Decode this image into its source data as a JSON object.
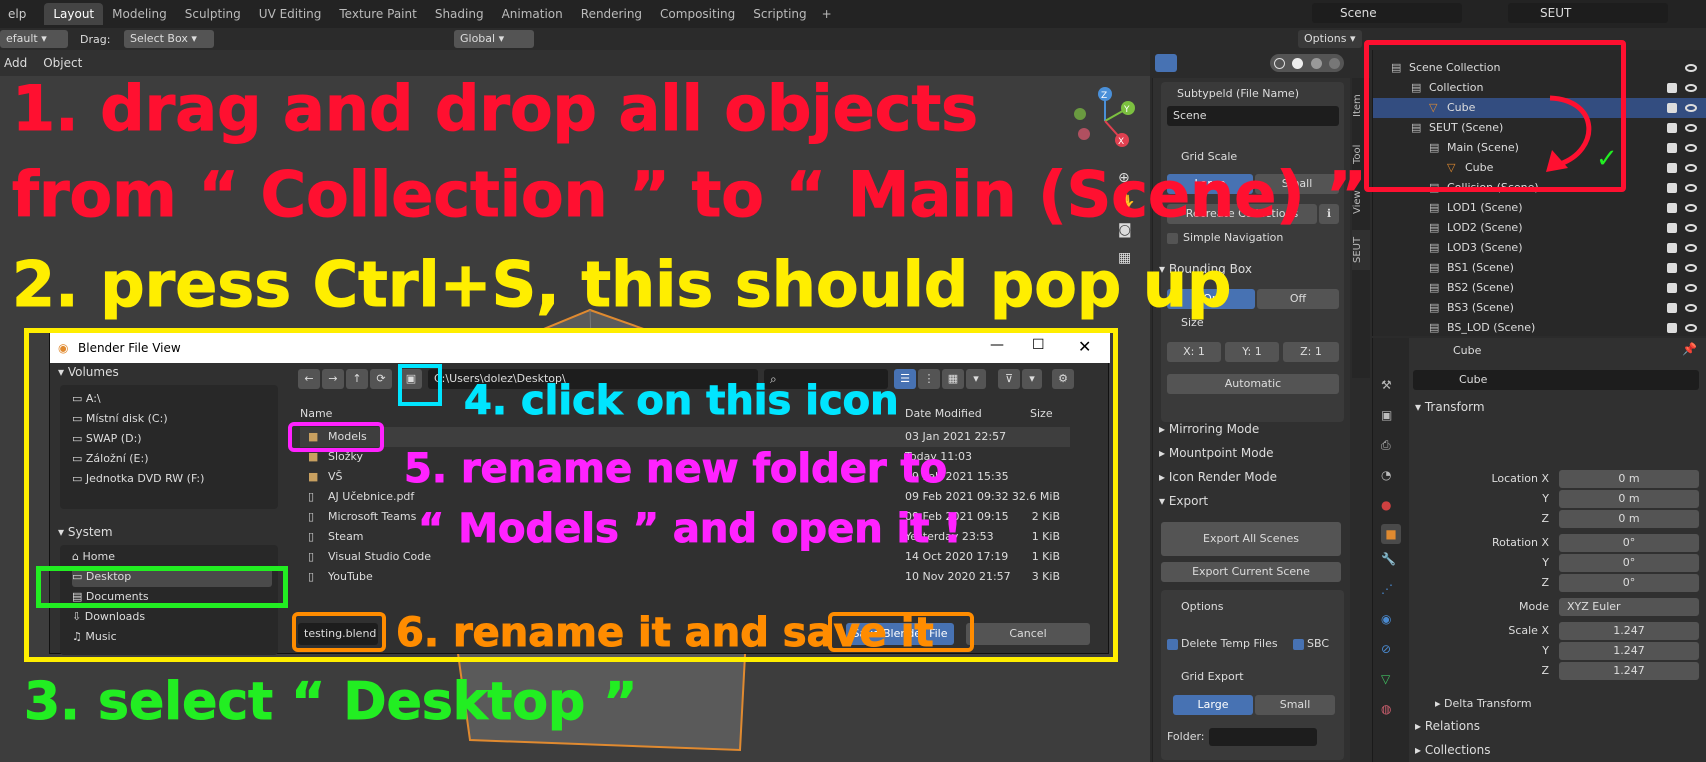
{
  "topbar": {
    "menu_help": "elp",
    "tabs": [
      "Layout",
      "Modeling",
      "Sculpting",
      "UV Editing",
      "Texture Paint",
      "Shading",
      "Animation",
      "Rendering",
      "Compositing",
      "Scripting"
    ],
    "add_tab": "+",
    "scene_name": "Scene",
    "view_layer": "SEUT"
  },
  "header2": {
    "mode": "efault",
    "drag_label": "Drag:",
    "drag_value": "Select Box",
    "orientation": "Global",
    "options": "Options"
  },
  "viewport_header": {
    "add": "Add",
    "object": "Object"
  },
  "gizmo": {
    "x": "X",
    "y": "Y",
    "z": "Z"
  },
  "npanel": {
    "subtype_label": "Subtypeld (File Name)",
    "subtype_value": "Scene",
    "grid_scale": "Grid Scale",
    "large": "Large",
    "small": "Small",
    "recreate": "Recreate Collections",
    "simple_nav": "Simple Navigation",
    "bounding_box": "Bounding Box",
    "on": "On",
    "off": "Off",
    "size": "Size",
    "bx": "X:  1",
    "by": "Y:  1",
    "bz": "Z:  1",
    "automatic": "Automatic",
    "mirroring": "Mirroring Mode",
    "mountpoint": "Mountpoint Mode",
    "icon_render": "Icon Render Mode",
    "export": "Export",
    "export_all": "Export All Scenes",
    "export_current": "Export Current Scene",
    "options": "Options",
    "delete_temp": "Delete Temp Files",
    "sbc": "SBC",
    "grid_export": "Grid Export",
    "folder": "Folder:",
    "tabs": [
      "Item",
      "Tool",
      "View",
      "SEUT"
    ]
  },
  "outliner": {
    "rows": [
      {
        "label": "Scene Collection"
      },
      {
        "label": "Collection"
      },
      {
        "label": "Cube"
      },
      {
        "label": "SEUT (Scene)"
      },
      {
        "label": "Main (Scene)"
      },
      {
        "label": "Cube"
      },
      {
        "label": "Collision (Scene)"
      },
      {
        "label": "LOD1 (Scene)"
      },
      {
        "label": "LOD2 (Scene)"
      },
      {
        "label": "LOD3 (Scene)"
      },
      {
        "label": "BS1 (Scene)"
      },
      {
        "label": "BS2 (Scene)"
      },
      {
        "label": "BS3 (Scene)"
      },
      {
        "label": "BS_LOD (Scene)"
      }
    ]
  },
  "props": {
    "object_name": "Cube",
    "object_field": "Cube",
    "transform": "Transform",
    "location_x": "Location X",
    "rotation_x": "Rotation X",
    "y": "Y",
    "z": "Z",
    "loc": [
      "0 m",
      "0 m",
      "0 m"
    ],
    "rot": [
      "0°",
      "0°",
      "0°"
    ],
    "mode_label": "Mode",
    "mode_value": "XYZ Euler",
    "scale_x": "Scale X",
    "scale": [
      "1.247",
      "1.247",
      "1.247"
    ],
    "delta": "Delta Transform",
    "relations": "Relations",
    "collections": "Collections"
  },
  "dialog": {
    "title": "Blender File View",
    "volumes": "Volumes",
    "volume_items": [
      "A:\\",
      "Místní disk (C:)",
      "SWAP (D:)",
      "Záložní (E:)",
      "Jednotka DVD RW (F:)"
    ],
    "system": "System",
    "system_items": [
      "Home",
      "Desktop",
      "Documents",
      "Downloads",
      "Music"
    ],
    "path": "C:\\Users\\dolez\\Desktop\\",
    "col_name": "Name",
    "col_date": "Date Modified",
    "col_size": "Size",
    "files": [
      {
        "name": "Models",
        "date": "03 Jan 2021 22:57",
        "size": ""
      },
      {
        "name": "Složky",
        "date": "Today 11:03",
        "size": ""
      },
      {
        "name": "VŠ",
        "date": "09 Feb 2021 15:35",
        "size": ""
      },
      {
        "name": "AJ Učebnice.pdf",
        "date": "09 Feb 2021 09:32",
        "size": "32.6 MiB"
      },
      {
        "name": "Microsoft Teams",
        "date": "09 Feb 2021 09:15",
        "size": "2 KiB"
      },
      {
        "name": "Steam",
        "date": "Yesterday 23:53",
        "size": "1 KiB"
      },
      {
        "name": "Visual Studio Code",
        "date": "14 Oct 2020 17:19",
        "size": "1 KiB"
      },
      {
        "name": "YouTube",
        "date": "10 Nov 2020 21:57",
        "size": "3 KiB"
      }
    ],
    "filename": "testing.blend",
    "save": "Save Blender File",
    "cancel": "Cancel"
  },
  "annotations": {
    "a1a": "1. drag and drop all objects",
    "a1b": "from “ Collection ” to “ Main (Scene) ”",
    "a2": "2. press Ctrl+S, this should pop up",
    "a3": "3. select “ Desktop ”",
    "a4": "4. click on this icon",
    "a5a": "5. rename new folder to",
    "a5b": "“ Models ” and open it !",
    "a6": "6. rename it and save it"
  },
  "colors": {
    "red": "#ff1030",
    "yellow": "#ffee00",
    "green": "#22ee22",
    "cyan": "#00e5ff",
    "magenta": "#ff22ff",
    "orange": "#ff8c00",
    "accent": "#4772b3"
  }
}
